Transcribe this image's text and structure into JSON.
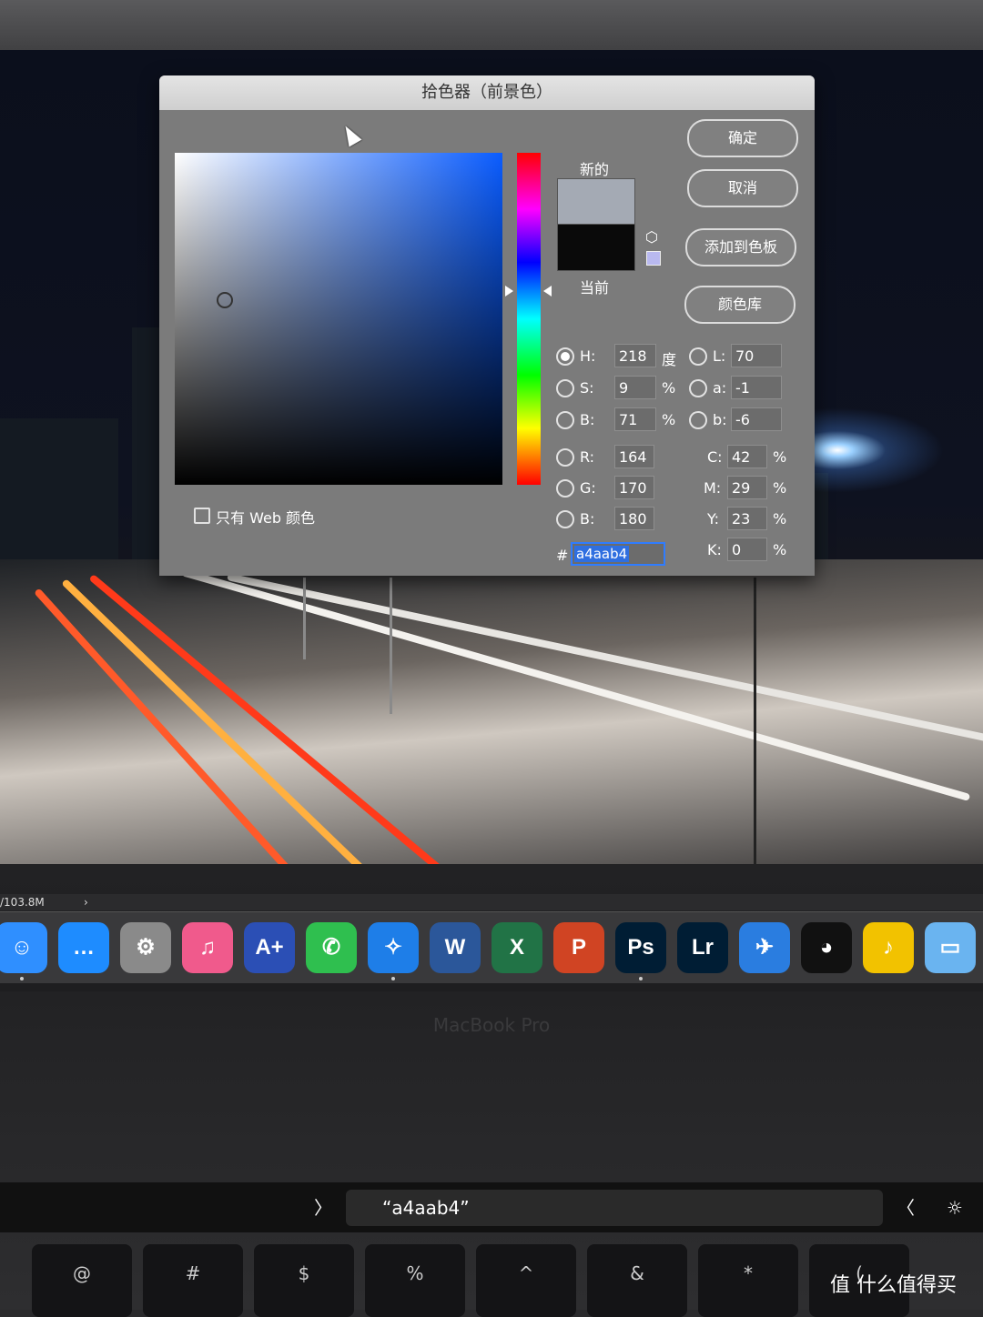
{
  "dialog": {
    "title": "拾色器（前景色）",
    "buttons": {
      "ok": "确定",
      "cancel": "取消",
      "add_swatch": "添加到色板",
      "libraries": "颜色库"
    },
    "swatch_labels": {
      "new": "新的",
      "current": "当前"
    },
    "web_only_label": "只有 Web 颜色",
    "hsb": [
      {
        "label": "H:",
        "value": "218",
        "unit": "度",
        "selected": true
      },
      {
        "label": "S:",
        "value": "9",
        "unit": "%",
        "selected": false
      },
      {
        "label": "B:",
        "value": "71",
        "unit": "%",
        "selected": false
      }
    ],
    "rgb": [
      {
        "label": "R:",
        "value": "164"
      },
      {
        "label": "G:",
        "value": "170"
      },
      {
        "label": "B:",
        "value": "180"
      }
    ],
    "lab": [
      {
        "label": "L:",
        "value": "70"
      },
      {
        "label": "a:",
        "value": "-1"
      },
      {
        "label": "b:",
        "value": "-6"
      }
    ],
    "cmyk": [
      {
        "label": "C:",
        "value": "42",
        "unit": "%"
      },
      {
        "label": "M:",
        "value": "29",
        "unit": "%"
      },
      {
        "label": "Y:",
        "value": "23",
        "unit": "%"
      },
      {
        "label": "K:",
        "value": "0",
        "unit": "%"
      }
    ],
    "hex_label": "#",
    "hex_value": "a4aab4",
    "new_color": "#a4aab4",
    "current_color": "#0a0a0a"
  },
  "status": {
    "text": "/103.8M",
    "arrow": "›"
  },
  "dock": {
    "apps": [
      {
        "name": "Finder",
        "glyph": "☺",
        "color": "#2f8fff"
      },
      {
        "name": "Messages",
        "glyph": "…",
        "color": "#1e8cff"
      },
      {
        "name": "System Preferences",
        "glyph": "⚙",
        "color": "#8a8a8a"
      },
      {
        "name": "iTunes",
        "glyph": "♫",
        "color": "#f05a8c"
      },
      {
        "name": "Dictionary",
        "glyph": "A+",
        "color": "#2b4fb5"
      },
      {
        "name": "FaceTime",
        "glyph": "✆",
        "color": "#2fbf4f"
      },
      {
        "name": "Safari",
        "glyph": "✧",
        "color": "#1e7ee8"
      },
      {
        "name": "Word",
        "glyph": "W",
        "color": "#2b579a"
      },
      {
        "name": "Excel",
        "glyph": "X",
        "color": "#217346"
      },
      {
        "name": "PowerPoint",
        "glyph": "P",
        "color": "#d04423"
      },
      {
        "name": "Photoshop",
        "glyph": "Ps",
        "color": "#001d34"
      },
      {
        "name": "Lightroom",
        "glyph": "Lr",
        "color": "#001d34"
      },
      {
        "name": "Xunlei",
        "glyph": "✈",
        "color": "#2a7de0"
      },
      {
        "name": "QQ",
        "glyph": "◕",
        "color": "#111111"
      },
      {
        "name": "QQ Music",
        "glyph": "♪",
        "color": "#f2c200"
      },
      {
        "name": "Folder",
        "glyph": "▭",
        "color": "#6ab4f0"
      }
    ]
  },
  "laptop": {
    "brand": "MacBook Pro"
  },
  "touchbar": {
    "left_chevron": "〉",
    "suggestion": "“a4aab4”",
    "right_chevron": "〈",
    "brightness": "☼"
  },
  "keys": [
    "@",
    "#",
    "$",
    "%",
    "^",
    "&",
    "*",
    "("
  ],
  "watermark": "值 什么值得买"
}
